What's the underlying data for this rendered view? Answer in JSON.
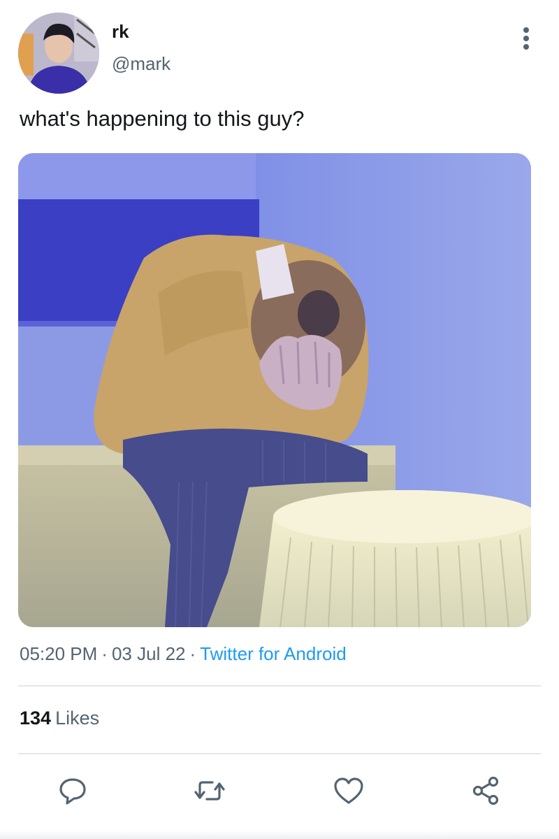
{
  "tweet": {
    "display_name": "rk",
    "handle": "@mark",
    "text": "what's happening to this guy?",
    "time": "05:20 PM",
    "date": "03 Jul 22",
    "separator": "·",
    "source": "Twitter for Android",
    "likes_count": "134",
    "likes_label": "Likes"
  },
  "icons": {
    "more": "more-vertical-icon",
    "reply": "reply-icon",
    "retweet": "retweet-icon",
    "like": "heart-icon",
    "share": "share-icon"
  },
  "colors": {
    "text": "#14171a",
    "secondary": "#536471",
    "link": "#1d9bf0",
    "divider": "#e3e7ea"
  }
}
